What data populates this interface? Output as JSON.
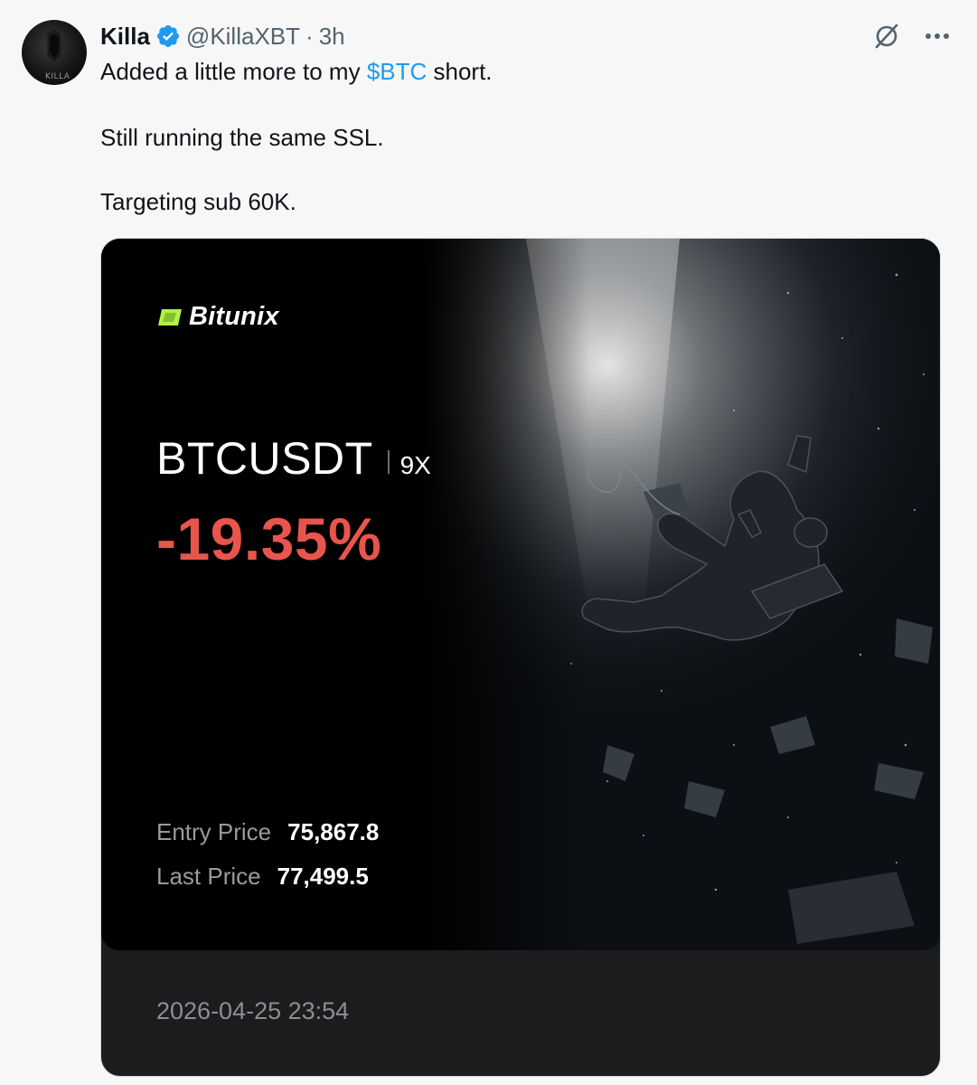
{
  "tweet": {
    "author_name": "Killa",
    "handle": "@KillaXBT",
    "separator": "·",
    "time": "3h",
    "avatar_text": "KILLA",
    "text_line1_pre": "Added a little more to my ",
    "cashtag": "$BTC",
    "text_line1_post": " short.",
    "text_line2": "Still running the same SSL.",
    "text_line3": "Targeting sub 60K."
  },
  "icons": {
    "grok": "grok-icon",
    "more": "more-icon",
    "verified": "verified-badge-icon"
  },
  "card": {
    "brand": "Bitunix",
    "pair": "BTCUSDT",
    "leverage": "9X",
    "pnl": "-19.35%",
    "entry_label": "Entry Price",
    "entry_value": "75,867.8",
    "last_label": "Last Price",
    "last_value": "77,499.5",
    "date": "2026-04-25 23:54"
  },
  "colors": {
    "cashtag": "#1d9bf0",
    "pnl": "#e8554c",
    "brand_accent": "#b4f046",
    "verified": "#1d9bf0"
  }
}
